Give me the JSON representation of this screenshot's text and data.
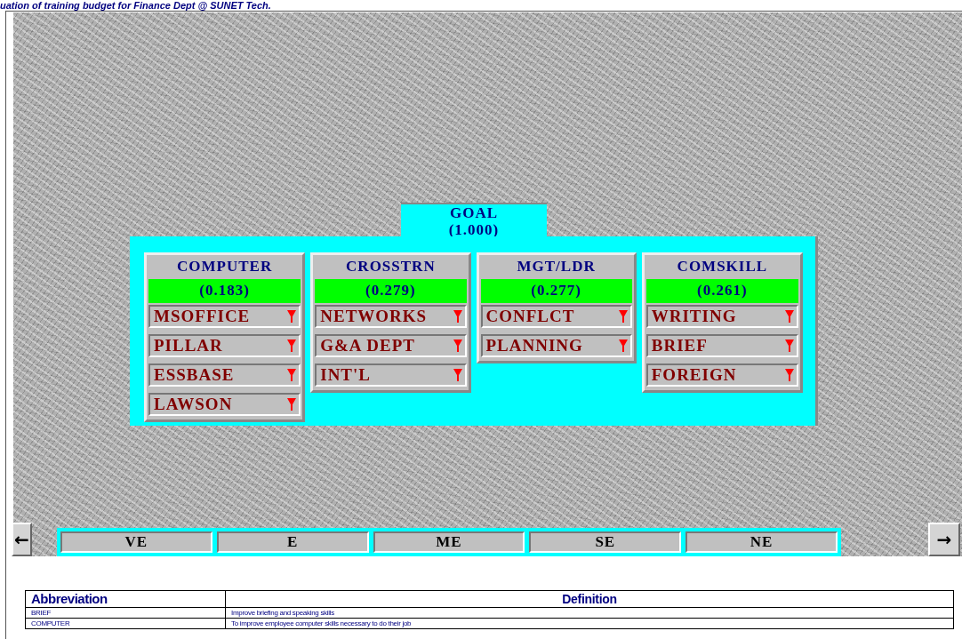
{
  "title": "uation of training budget for Finance Dept @ SUNET Tech.",
  "goal": {
    "label": "GOAL",
    "value": "(1.000)"
  },
  "criteria": [
    {
      "name": "COMPUTER",
      "value": "(0.183)",
      "items": [
        "MSOFFICE",
        "PILLAR",
        "ESSBASE",
        "LAWSON"
      ]
    },
    {
      "name": "CROSSTRN",
      "value": "(0.279)",
      "items": [
        "NETWORKS",
        "G&A DEPT",
        "INT'L"
      ]
    },
    {
      "name": "MGT/LDR",
      "value": "(0.277)",
      "items": [
        "CONFLCT",
        "PLANNING"
      ]
    },
    {
      "name": "COMSKILL",
      "value": "(0.261)",
      "items": [
        "WRITING",
        "BRIEF",
        "FOREIGN"
      ]
    }
  ],
  "nav": {
    "left": "←",
    "right": "→"
  },
  "scale": [
    "VE",
    "E",
    "ME",
    "SE",
    "NE"
  ],
  "table": {
    "columns": [
      "Abbreviation",
      "Definition"
    ],
    "rows": [
      [
        "BRIEF",
        "Improve briefing and speaking skills"
      ],
      [
        "COMPUTER",
        "To improve employee computer skills necessary to do their job"
      ]
    ]
  }
}
